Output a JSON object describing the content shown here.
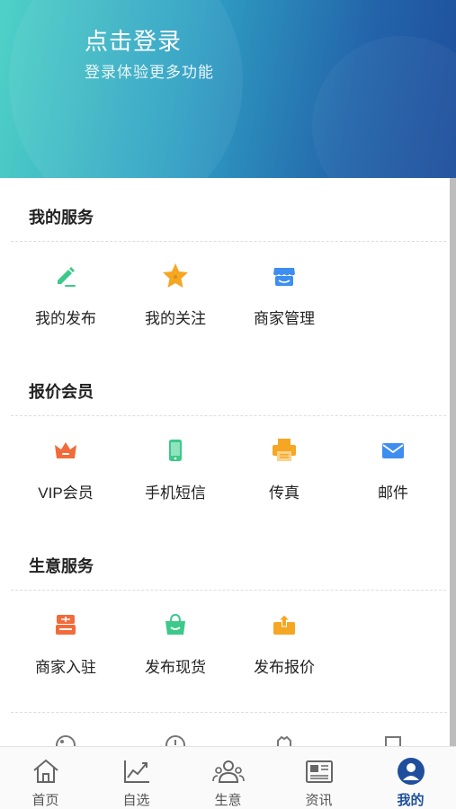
{
  "header": {
    "title": "点击登录",
    "subtitle": "登录体验更多功能"
  },
  "sections": [
    {
      "title": "我的服务",
      "items": [
        {
          "label": "我的发布",
          "icon": "pencil-icon",
          "color": "#3cc98a"
        },
        {
          "label": "我的关注",
          "icon": "star-icon",
          "color": "#f5a623"
        },
        {
          "label": "商家管理",
          "icon": "store-icon",
          "color": "#3d8ef0"
        }
      ]
    },
    {
      "title": "报价会员",
      "items": [
        {
          "label": "VIP会员",
          "icon": "crown-icon",
          "color": "#f26b3a"
        },
        {
          "label": "手机短信",
          "icon": "phone-icon",
          "color": "#3cc98a"
        },
        {
          "label": "传真",
          "icon": "printer-icon",
          "color": "#f5a623"
        },
        {
          "label": "邮件",
          "icon": "mail-icon",
          "color": "#3d8ef0"
        }
      ]
    },
    {
      "title": "生意服务",
      "items": [
        {
          "label": "商家入驻",
          "icon": "shop-enter-icon",
          "color": "#f26b3a"
        },
        {
          "label": "发布现货",
          "icon": "bag-icon",
          "color": "#3cc98a"
        },
        {
          "label": "发布报价",
          "icon": "upload-box-icon",
          "color": "#f5a623"
        }
      ]
    }
  ],
  "tabs": [
    {
      "label": "首页",
      "icon": "home-icon"
    },
    {
      "label": "自选",
      "icon": "chart-line-icon"
    },
    {
      "label": "生意",
      "icon": "people-icon"
    },
    {
      "label": "资讯",
      "icon": "news-icon"
    },
    {
      "label": "我的",
      "icon": "user-icon",
      "active": true
    }
  ],
  "colors": {
    "accent": "#1f4f9c",
    "green": "#3cc98a",
    "orange": "#f5a623",
    "red": "#f26b3a",
    "blue": "#3d8ef0"
  }
}
